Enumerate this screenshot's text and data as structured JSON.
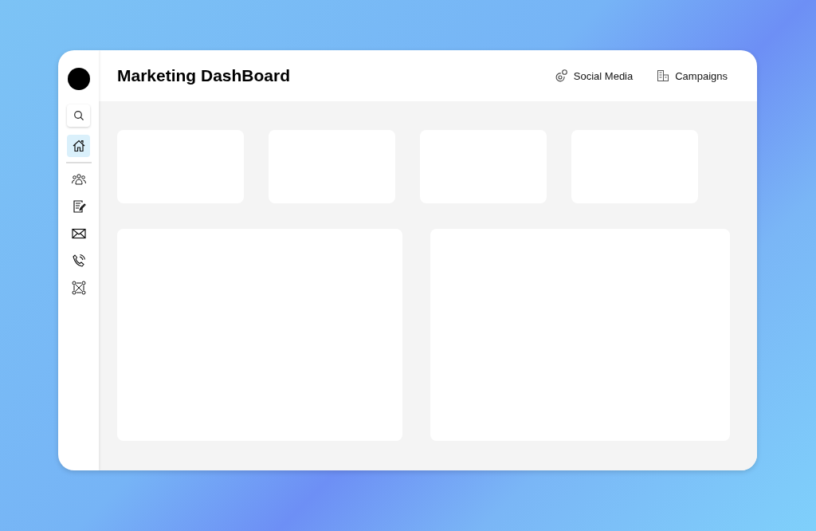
{
  "header": {
    "title": "Marketing DashBoard",
    "links": [
      {
        "kind": "social",
        "label": "Social Media"
      },
      {
        "kind": "campaigns",
        "label": "Campaigns"
      }
    ]
  },
  "sidebar": {
    "items": [
      {
        "kind": "home",
        "selected": true
      },
      {
        "kind": "team",
        "selected": false
      },
      {
        "kind": "notes",
        "selected": false
      },
      {
        "kind": "mail",
        "selected": false
      },
      {
        "kind": "phone",
        "selected": false
      },
      {
        "kind": "network",
        "selected": false
      }
    ]
  }
}
